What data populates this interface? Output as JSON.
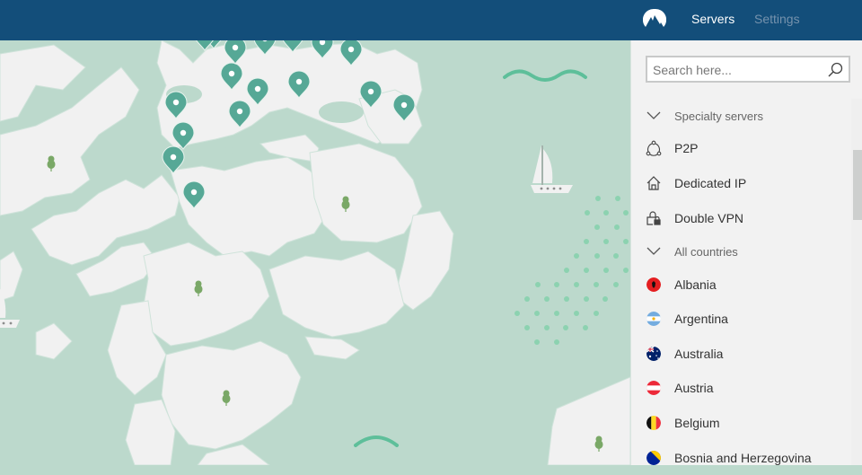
{
  "header": {
    "logo": "nordvpn-mountain-logo",
    "tabs": [
      {
        "label": "Servers",
        "active": true
      },
      {
        "label": "Settings",
        "active": false
      }
    ]
  },
  "sidebar": {
    "search": {
      "placeholder": "Search here...",
      "value": "",
      "icon": "search-icon"
    },
    "specialty_section": {
      "label": "Specialty servers",
      "icon": "chevron-down-icon"
    },
    "specialty_items": [
      {
        "label": "P2P",
        "icon": "p2p-network-icon"
      },
      {
        "label": "Dedicated IP",
        "icon": "home-icon"
      },
      {
        "label": "Double VPN",
        "icon": "double-lock-icon"
      }
    ],
    "countries_section": {
      "label": "All countries",
      "icon": "chevron-down-icon"
    },
    "countries": [
      {
        "label": "Albania",
        "flag": "albania-flag"
      },
      {
        "label": "Argentina",
        "flag": "argentina-flag"
      },
      {
        "label": "Australia",
        "flag": "australia-flag"
      },
      {
        "label": "Austria",
        "flag": "austria-flag"
      },
      {
        "label": "Belgium",
        "flag": "belgium-flag"
      },
      {
        "label": "Bosnia and Herzegovina",
        "flag": "bosnia-flag"
      }
    ]
  },
  "map": {
    "server_pin_count": 17,
    "colors": {
      "sea": "#bcd9cc",
      "land": "#f1f1f1",
      "pin": "#56a896",
      "tree": "#7aa867",
      "header": "#134e7a"
    }
  }
}
